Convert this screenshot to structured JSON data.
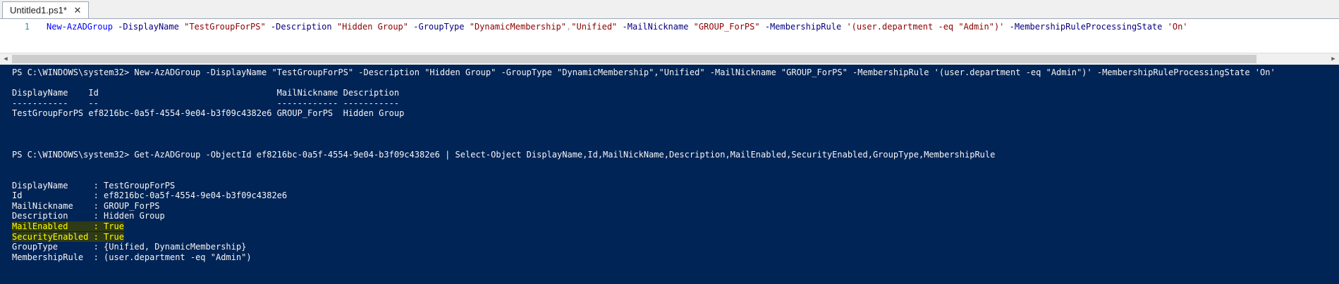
{
  "tab": {
    "title": "Untitled1.ps1*",
    "close_glyph": "✕"
  },
  "editor": {
    "line_number": "1",
    "tokens": {
      "cmd": "New-AzADGroup",
      "p1": "-DisplayName",
      "v1": "\"TestGroupForPS\"",
      "p2": "-Description",
      "v2": "\"Hidden Group\"",
      "p3": "-GroupType",
      "v3a": "\"DynamicMembership\"",
      "comma": ",",
      "v3b": "\"Unified\"",
      "p4": "-MailNickname",
      "v4": "\"GROUP_ForPS\"",
      "p5": "-MembershipRule",
      "v5": "'(user.department -eq \"Admin\")'",
      "p6": "-MembershipRuleProcessingState",
      "v6": "'On'"
    }
  },
  "scrollbar": {
    "left_glyph": "◀",
    "right_glyph": "▶"
  },
  "console": {
    "lines": [
      "PS C:\\WINDOWS\\system32> New-AzADGroup -DisplayName \"TestGroupForPS\" -Description \"Hidden Group\" -GroupType \"DynamicMembership\",\"Unified\" -MailNickname \"GROUP_ForPS\" -MembershipRule '(user.department -eq \"Admin\")' -MembershipRuleProcessingState 'On'",
      "",
      "DisplayName    Id                                   MailNickname Description",
      "-----------    --                                   ------------ -----------",
      "TestGroupForPS ef8216bc-0a5f-4554-9e04-b3f09c4382e6 GROUP_ForPS  Hidden Group",
      "",
      "",
      "",
      "PS C:\\WINDOWS\\system32> Get-AzADGroup -ObjectId ef8216bc-0a5f-4554-9e04-b3f09c4382e6 | Select-Object DisplayName,Id,MailNickName,Description,MailEnabled,SecurityEnabled,GroupType,MembershipRule",
      "",
      "",
      "DisplayName     : TestGroupForPS",
      "Id              : ef8216bc-0a5f-4554-9e04-b3f09c4382e6",
      "MailNickname    : GROUP_ForPS",
      "Description     : Hidden Group",
      "MailEnabled     : True",
      "SecurityEnabled : True",
      "GroupType       : {Unified, DynamicMembership}",
      "MembershipRule  : (user.department -eq \"Admin\")"
    ]
  },
  "colors": {
    "console_bg": "#012456",
    "console_fg": "#f5f5f5",
    "highlight_fg": "#ffff00",
    "cmdlet": "#0000ff",
    "parameter": "#000080",
    "string": "#8b0000"
  },
  "icons": {
    "tab_close": "close-icon",
    "scroll_left": "chevron-left-icon",
    "scroll_right": "chevron-right-icon"
  }
}
